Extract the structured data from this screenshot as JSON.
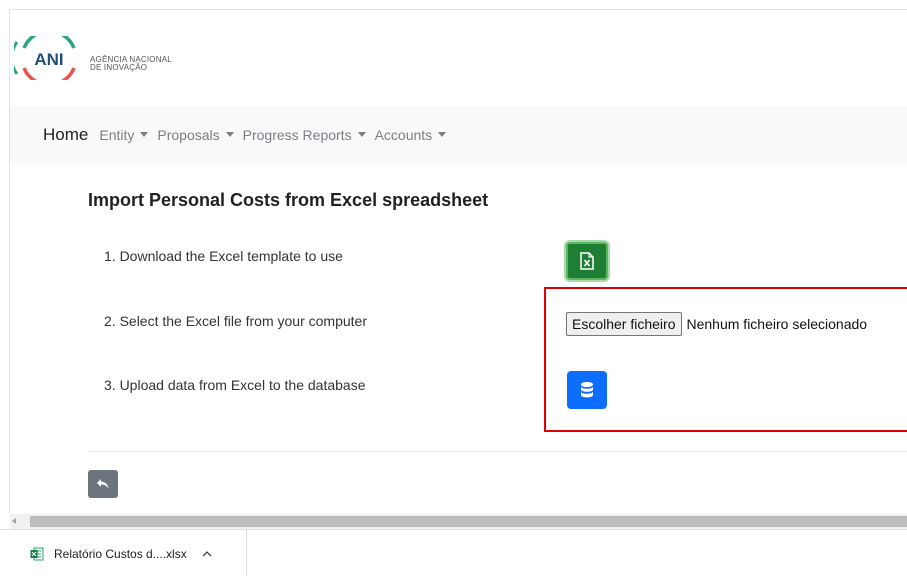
{
  "logo": {
    "mark": "ANI",
    "line1": "AGÊNCIA NACIONAL",
    "line2": "DE INOVAÇÃO"
  },
  "navbar": {
    "home": "Home",
    "items": [
      {
        "label": "Entity",
        "icon": "caret-down-icon"
      },
      {
        "label": "Proposals",
        "icon": "caret-down-icon"
      },
      {
        "label": "Progress Reports",
        "icon": "caret-down-icon"
      },
      {
        "label": "Accounts",
        "icon": "caret-down-icon"
      }
    ]
  },
  "main": {
    "heading": "Import Personal Costs from Excel spreadsheet",
    "steps": [
      {
        "text": "1. Download the Excel template to use",
        "action_icon": "excel-file-icon"
      },
      {
        "text": "2. Select the Excel file from your computer"
      },
      {
        "text": "3. Upload data from Excel to the database",
        "action_icon": "database-icon"
      }
    ],
    "file_input": {
      "button_label": "Escolher ficheiro",
      "status": "Nenhum ficheiro selecionado"
    },
    "back_icon": "reply-arrow-icon"
  },
  "download_bar": {
    "file_name": "Relatório Custos d....xlsx",
    "file_icon": "excel-file-icon",
    "chevron_icon": "chevron-up-icon"
  },
  "colors": {
    "excel_button": "#1e7e34",
    "upload_button": "#0d6efd",
    "back_button": "#6c757d",
    "highlight_border": "#e00000",
    "logo_green": "#2aa87a",
    "logo_red": "#e8534a"
  }
}
